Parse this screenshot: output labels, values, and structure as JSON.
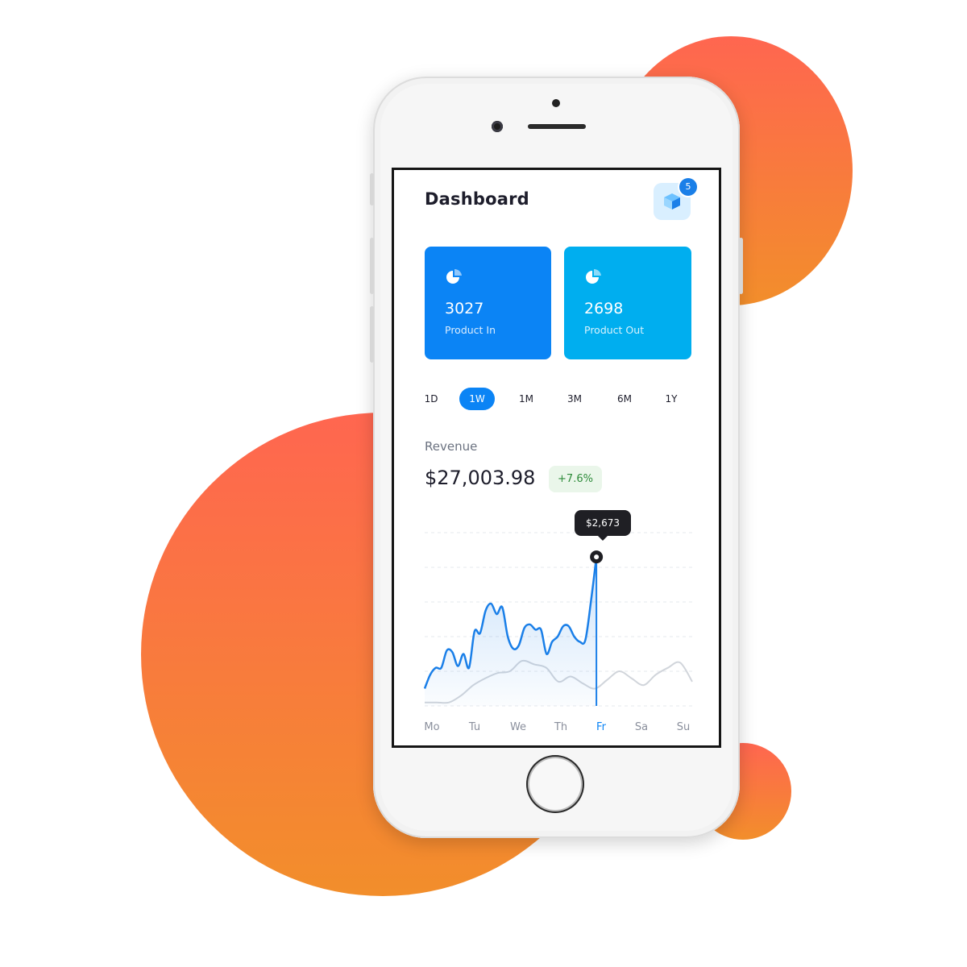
{
  "header": {
    "title": "Dashboard",
    "notification_count": "5"
  },
  "cards": [
    {
      "value": "3027",
      "label": "Product In",
      "color": "#0b84f5"
    },
    {
      "value": "2698",
      "label": "Product Out",
      "color": "#00aeef"
    }
  ],
  "periods": [
    "1D",
    "1W",
    "1M",
    "3M",
    "6M",
    "1Y"
  ],
  "active_period": "1W",
  "revenue": {
    "label": "Revenue",
    "amount": "$27,003.98",
    "change": "+7.6%"
  },
  "tooltip": {
    "value": "$2,673"
  },
  "chart_data": {
    "type": "area",
    "categories": [
      "Mo",
      "Tu",
      "We",
      "Th",
      "Fr",
      "Sa",
      "Su"
    ],
    "highlighted_category": "Fr",
    "series": [
      {
        "color": "#1a7fe8",
        "values": [
          0.1,
          0.18,
          0.22,
          0.22,
          0.32,
          0.31,
          0.23,
          0.3,
          0.22,
          0.43,
          0.42,
          0.55,
          0.59,
          0.53,
          0.57,
          0.4,
          0.33,
          0.35,
          0.45,
          0.47,
          0.44,
          0.44,
          0.3,
          0.37,
          0.4,
          0.46,
          0.46,
          0.4,
          0.37,
          0.38,
          0.6,
          0.86,
          0.78
        ]
      },
      {
        "color": "#d1d5db",
        "values": [
          0.02,
          0.02,
          0.02,
          0.06,
          0.12,
          0.16,
          0.19,
          0.2,
          0.26,
          0.24,
          0.22,
          0.14,
          0.17,
          0.13,
          0.1,
          0.15,
          0.2,
          0.16,
          0.12,
          0.18,
          0.22,
          0.25,
          0.14
        ]
      }
    ],
    "grid": true
  }
}
